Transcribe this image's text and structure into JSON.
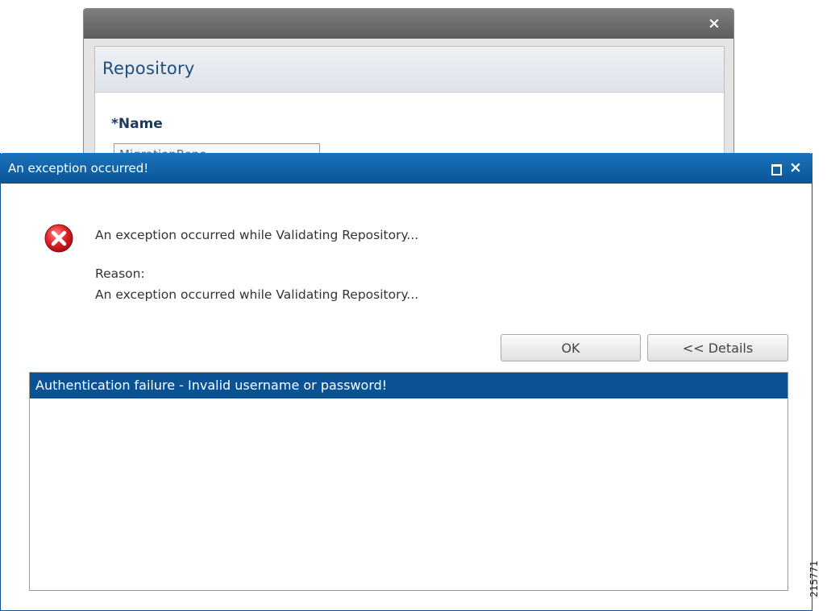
{
  "repository_dialog": {
    "close_glyph": "×",
    "panel_title": "Repository",
    "name_label": "*Name",
    "name_value": "MigrationRepo"
  },
  "error_dialog": {
    "title": "An exception occurred!",
    "message": "An exception occurred while Validating Repository...",
    "reason_label": "Reason:",
    "reason_text": "An exception occurred while Validating Repository...",
    "ok_label": "OK",
    "details_label": "<< Details",
    "close_glyph": "×",
    "details_rows": [
      "Authentication failure - Invalid username or password!"
    ]
  },
  "figure_id": "215771",
  "colors": {
    "title_bar": "#0a5294",
    "selection": "#0a5294",
    "error_icon": "#d9232a"
  }
}
